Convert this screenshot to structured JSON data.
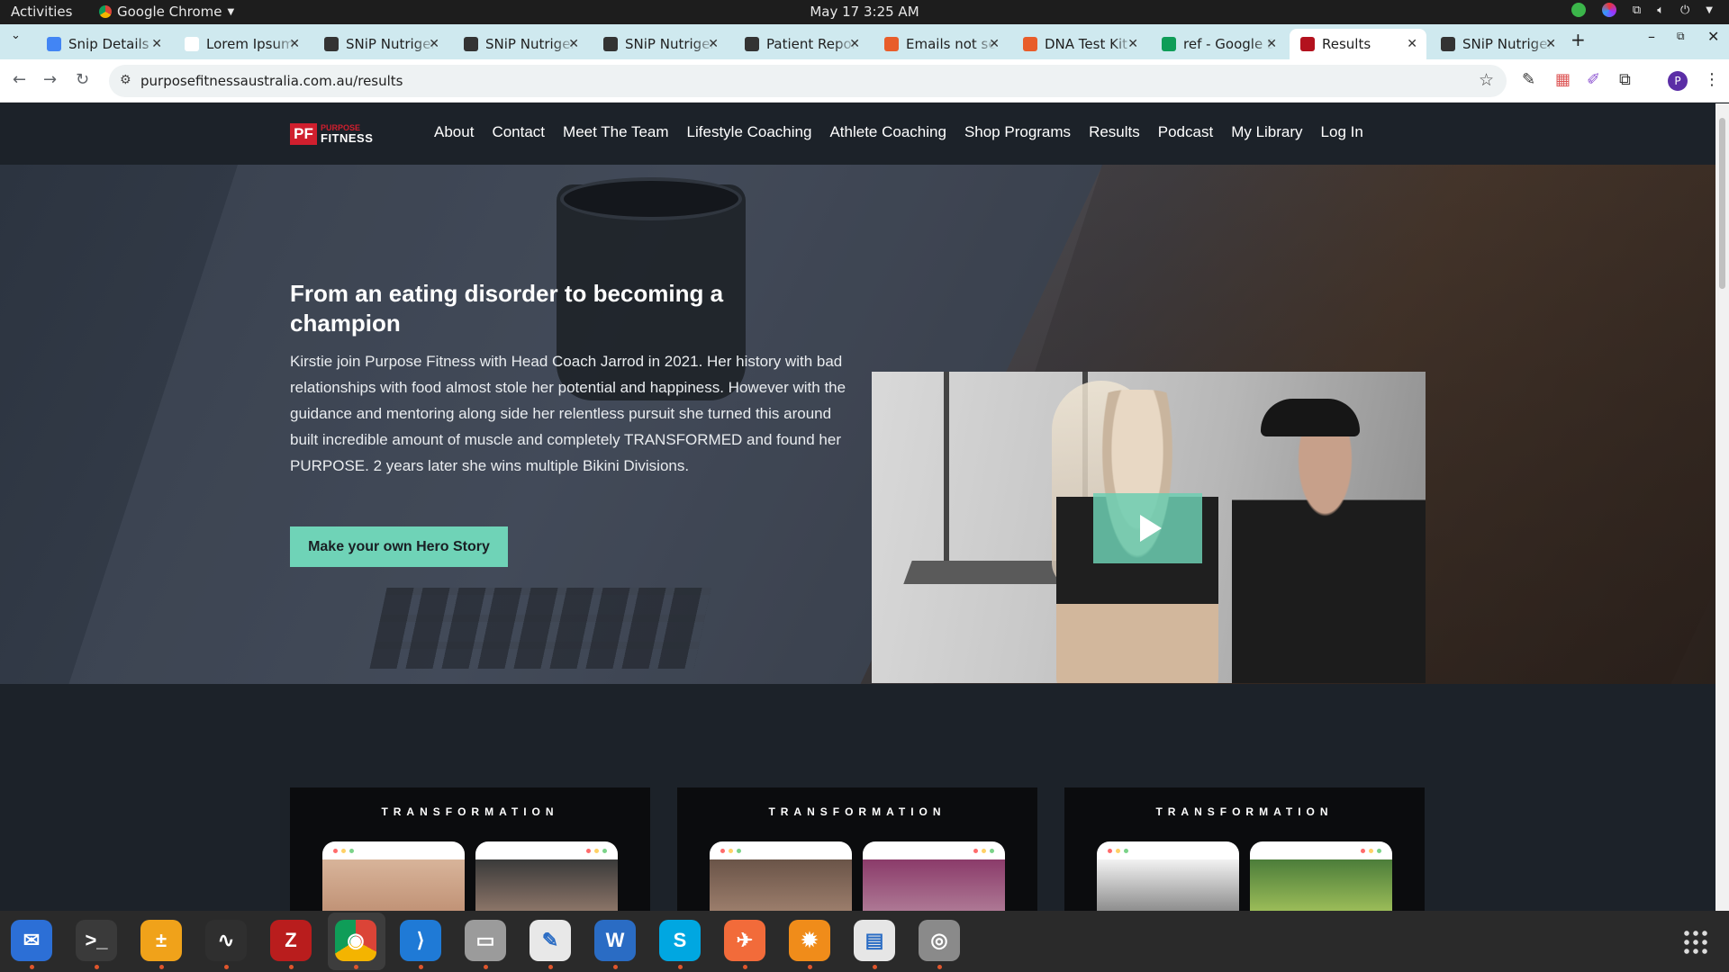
{
  "system_bar": {
    "activities": "Activities",
    "app_name": "Google Chrome",
    "clock": "May 17  3:25 AM"
  },
  "tabs": [
    {
      "title": "Snip Details",
      "favicon_color": "#4285f4"
    },
    {
      "title": "Lorem Ipsum",
      "favicon_color": "#ffffff"
    },
    {
      "title": "SNiP Nutrigenomics",
      "favicon_color": "#333333"
    },
    {
      "title": "SNiP Nutrigenomics",
      "favicon_color": "#333333"
    },
    {
      "title": "SNiP Nutrigenomics",
      "favicon_color": "#333333"
    },
    {
      "title": "Patient Report",
      "favicon_color": "#333333"
    },
    {
      "title": "Emails not sent",
      "favicon_color": "#e85d2a"
    },
    {
      "title": "DNA Test Kit",
      "favicon_color": "#e85d2a"
    },
    {
      "title": "ref - Google Sheets",
      "favicon_color": "#0f9d58"
    },
    {
      "title": "Results",
      "favicon_color": "#b3121e",
      "active": true
    },
    {
      "title": "SNiP Nutrigenomics",
      "favicon_color": "#333333"
    }
  ],
  "address_bar": {
    "url": "purposefitnessaustralia.com.au/results"
  },
  "profile_initial": "P",
  "site": {
    "logo": {
      "mark": "PF",
      "line1": "PURPOSE",
      "line2": "FITNESS"
    },
    "menu": [
      "About",
      "Contact",
      "Meet The Team",
      "Lifestyle Coaching",
      "Athlete Coaching",
      "Shop Programs",
      "Results",
      "Podcast",
      "My Library",
      "Log In"
    ],
    "hero": {
      "title": "From an eating disorder to becoming a champion",
      "body": "Kirstie join Purpose Fitness with Head Coach Jarrod in 2021. Her history with bad relationships with food almost stole her potential and happiness. However with the guidance and mentoring along side her relentless pursuit she turned this around built incredible amount of muscle and completely TRANSFORMED and found her PURPOSE. 2 years later she wins multiple Bikini Divisions.",
      "cta": "Make your own Hero Story"
    },
    "cards": [
      {
        "label": "TRANSFORMATION"
      },
      {
        "label": "TRANSFORMATION"
      },
      {
        "label": "TRANSFORMATION"
      }
    ]
  },
  "accent_color": "#6fd3b7",
  "dock_apps": [
    "thunderbird",
    "terminal",
    "calculator",
    "system-monitor",
    "filezilla",
    "chrome",
    "vscode",
    "files",
    "text-editor",
    "libreoffice-writer",
    "skype",
    "postman",
    "blender",
    "document-scanner",
    "disks"
  ]
}
